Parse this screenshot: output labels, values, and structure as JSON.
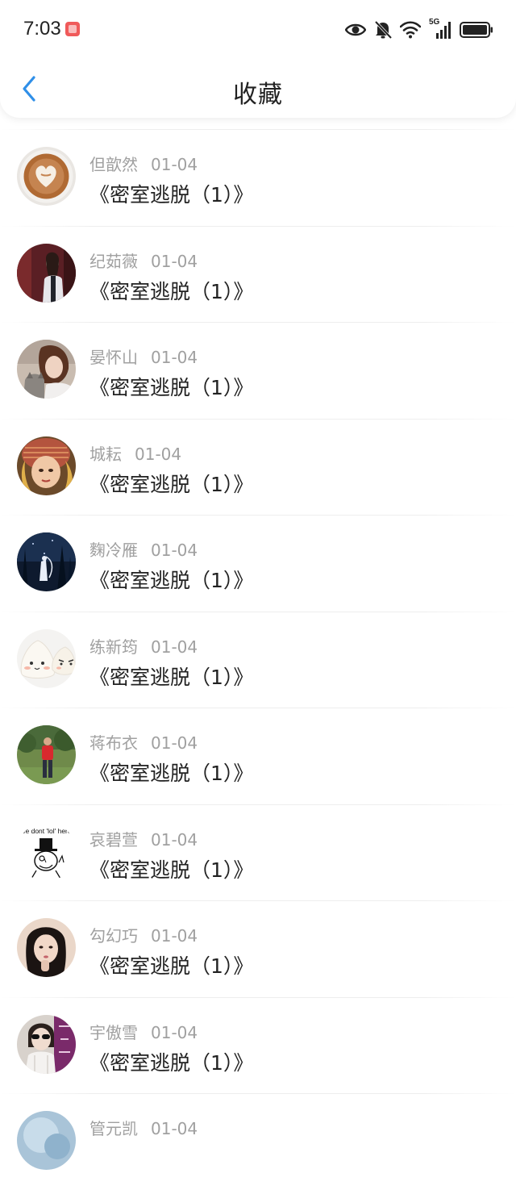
{
  "status_bar": {
    "time": "7:03",
    "network_label": "5G",
    "icons": [
      "notification-icon",
      "eye-icon",
      "bell-off-icon",
      "wifi-icon",
      "signal-5g-icon",
      "battery-icon"
    ]
  },
  "header": {
    "title": "收藏",
    "back_icon": "chevron-left-icon",
    "accent_color": "#2f8fe8"
  },
  "favorites": [
    {
      "name": "但歆然",
      "date": "01-04",
      "title": "《密室逃脱（1）》",
      "avatar": "latte-art"
    },
    {
      "name": "纪茹薇",
      "date": "01-04",
      "title": "《密室逃脱（1）》",
      "avatar": "woman-jacket"
    },
    {
      "name": "晏怀山",
      "date": "01-04",
      "title": "《密室逃脱（1）》",
      "avatar": "woman-cat"
    },
    {
      "name": "城耘",
      "date": "01-04",
      "title": "《密室逃脱（1）》",
      "avatar": "girl-knit-hat"
    },
    {
      "name": "麴冷雁",
      "date": "01-04",
      "title": "《密室逃脱（1）》",
      "avatar": "night-forest-girl"
    },
    {
      "name": "练新筠",
      "date": "01-04",
      "title": "《密室逃脱（1）》",
      "avatar": "rice-dumplings"
    },
    {
      "name": "蒋布衣",
      "date": "01-04",
      "title": "《密室逃脱（1）》",
      "avatar": "man-in-field"
    },
    {
      "name": "哀碧萱",
      "date": "01-04",
      "title": "《密室逃脱（1）》",
      "avatar": "meme-top-hat",
      "avatar_caption": "we dont 'lol' here"
    },
    {
      "name": "勾幻巧",
      "date": "01-04",
      "title": "《密室逃脱（1）》",
      "avatar": "girl-portrait"
    },
    {
      "name": "宇傲雪",
      "date": "01-04",
      "title": "《密室逃脱（1）》",
      "avatar": "girl-sunglasses"
    },
    {
      "name": "管元凯",
      "date": "01-04",
      "title": "",
      "avatar": "light-blue"
    }
  ]
}
